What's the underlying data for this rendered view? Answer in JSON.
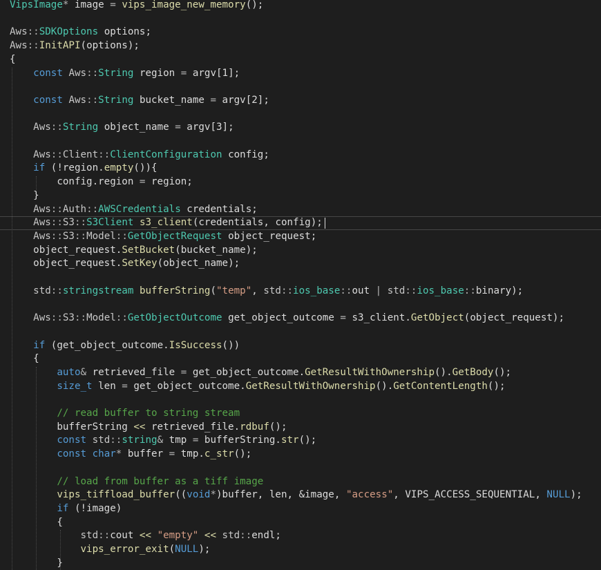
{
  "theme": {
    "background": "#1e1e1e",
    "text": "#dcdcdc",
    "keyword": "#569cd6",
    "type": "#4ec9b0",
    "function": "#dcdcaa",
    "string": "#d69d85",
    "comment": "#57a64a",
    "macro": "#b8d7a3"
  },
  "editor": {
    "current_line": 16,
    "lines": [
      [
        {
          "c": "t",
          "x": "VipsImage"
        },
        {
          "c": "op",
          "x": "* "
        },
        {
          "c": "v",
          "x": "image"
        },
        {
          "c": "op",
          "x": " = "
        },
        {
          "c": "f",
          "x": "vips_image_new_memory"
        },
        {
          "c": "p",
          "x": "();"
        }
      ],
      [],
      [
        {
          "c": "ns",
          "x": "Aws"
        },
        {
          "c": "op",
          "x": "::"
        },
        {
          "c": "t",
          "x": "SDKOptions"
        },
        {
          "c": "p",
          "x": " "
        },
        {
          "c": "v",
          "x": "options"
        },
        {
          "c": "p",
          "x": ";"
        }
      ],
      [
        {
          "c": "ns",
          "x": "Aws"
        },
        {
          "c": "op",
          "x": "::"
        },
        {
          "c": "f",
          "x": "InitAPI"
        },
        {
          "c": "p",
          "x": "("
        },
        {
          "c": "v",
          "x": "options"
        },
        {
          "c": "p",
          "x": ");"
        }
      ],
      [
        {
          "c": "p",
          "x": "{"
        }
      ],
      [
        {
          "c": "p",
          "x": "    "
        },
        {
          "c": "k",
          "x": "const"
        },
        {
          "c": "p",
          "x": " "
        },
        {
          "c": "ns",
          "x": "Aws"
        },
        {
          "c": "op",
          "x": "::"
        },
        {
          "c": "t",
          "x": "String"
        },
        {
          "c": "p",
          "x": " "
        },
        {
          "c": "v",
          "x": "region"
        },
        {
          "c": "op",
          "x": " = "
        },
        {
          "c": "v",
          "x": "argv"
        },
        {
          "c": "p",
          "x": "[1];"
        }
      ],
      [],
      [
        {
          "c": "p",
          "x": "    "
        },
        {
          "c": "k",
          "x": "const"
        },
        {
          "c": "p",
          "x": " "
        },
        {
          "c": "ns",
          "x": "Aws"
        },
        {
          "c": "op",
          "x": "::"
        },
        {
          "c": "t",
          "x": "String"
        },
        {
          "c": "p",
          "x": " "
        },
        {
          "c": "v",
          "x": "bucket_name"
        },
        {
          "c": "op",
          "x": " = "
        },
        {
          "c": "v",
          "x": "argv"
        },
        {
          "c": "p",
          "x": "[2];"
        }
      ],
      [],
      [
        {
          "c": "p",
          "x": "    "
        },
        {
          "c": "ns",
          "x": "Aws"
        },
        {
          "c": "op",
          "x": "::"
        },
        {
          "c": "t",
          "x": "String"
        },
        {
          "c": "p",
          "x": " "
        },
        {
          "c": "v",
          "x": "object_name"
        },
        {
          "c": "op",
          "x": " = "
        },
        {
          "c": "v",
          "x": "argv"
        },
        {
          "c": "p",
          "x": "[3];"
        }
      ],
      [],
      [
        {
          "c": "p",
          "x": "    "
        },
        {
          "c": "ns",
          "x": "Aws"
        },
        {
          "c": "op",
          "x": "::"
        },
        {
          "c": "ns",
          "x": "Client"
        },
        {
          "c": "op",
          "x": "::"
        },
        {
          "c": "t",
          "x": "ClientConfiguration"
        },
        {
          "c": "p",
          "x": " "
        },
        {
          "c": "v",
          "x": "config"
        },
        {
          "c": "p",
          "x": ";"
        }
      ],
      [
        {
          "c": "p",
          "x": "    "
        },
        {
          "c": "k",
          "x": "if"
        },
        {
          "c": "p",
          "x": " (!"
        },
        {
          "c": "v",
          "x": "region"
        },
        {
          "c": "p",
          "x": "."
        },
        {
          "c": "f",
          "x": "empty"
        },
        {
          "c": "p",
          "x": "()){"
        }
      ],
      [
        {
          "c": "p",
          "x": "        "
        },
        {
          "c": "v",
          "x": "config"
        },
        {
          "c": "p",
          "x": "."
        },
        {
          "c": "v",
          "x": "region"
        },
        {
          "c": "op",
          "x": " = "
        },
        {
          "c": "v",
          "x": "region"
        },
        {
          "c": "p",
          "x": ";"
        }
      ],
      [
        {
          "c": "p",
          "x": "    }"
        }
      ],
      [
        {
          "c": "p",
          "x": "    "
        },
        {
          "c": "ns",
          "x": "Aws"
        },
        {
          "c": "op",
          "x": "::"
        },
        {
          "c": "ns",
          "x": "Auth"
        },
        {
          "c": "op",
          "x": "::"
        },
        {
          "c": "t",
          "x": "AWSCredentials"
        },
        {
          "c": "p",
          "x": " "
        },
        {
          "c": "v",
          "x": "credentials"
        },
        {
          "c": "p",
          "x": ";"
        }
      ],
      [
        {
          "c": "p",
          "x": "    "
        },
        {
          "c": "ns",
          "x": "Aws"
        },
        {
          "c": "op",
          "x": "::"
        },
        {
          "c": "ns",
          "x": "S3"
        },
        {
          "c": "op",
          "x": "::"
        },
        {
          "c": "t",
          "x": "S3Client"
        },
        {
          "c": "p",
          "x": " "
        },
        {
          "c": "f",
          "x": "s3_client"
        },
        {
          "c": "p",
          "x": "("
        },
        {
          "c": "v",
          "x": "credentials"
        },
        {
          "c": "p",
          "x": ", "
        },
        {
          "c": "v",
          "x": "config"
        },
        {
          "c": "p",
          "x": ");"
        }
      ],
      [
        {
          "c": "p",
          "x": "    "
        },
        {
          "c": "ns",
          "x": "Aws"
        },
        {
          "c": "op",
          "x": "::"
        },
        {
          "c": "ns",
          "x": "S3"
        },
        {
          "c": "op",
          "x": "::"
        },
        {
          "c": "ns",
          "x": "Model"
        },
        {
          "c": "op",
          "x": "::"
        },
        {
          "c": "t",
          "x": "GetObjectRequest"
        },
        {
          "c": "p",
          "x": " "
        },
        {
          "c": "v",
          "x": "object_request"
        },
        {
          "c": "p",
          "x": ";"
        }
      ],
      [
        {
          "c": "p",
          "x": "    "
        },
        {
          "c": "v",
          "x": "object_request"
        },
        {
          "c": "p",
          "x": "."
        },
        {
          "c": "f",
          "x": "SetBucket"
        },
        {
          "c": "p",
          "x": "("
        },
        {
          "c": "v",
          "x": "bucket_name"
        },
        {
          "c": "p",
          "x": ");"
        }
      ],
      [
        {
          "c": "p",
          "x": "    "
        },
        {
          "c": "v",
          "x": "object_request"
        },
        {
          "c": "p",
          "x": "."
        },
        {
          "c": "f",
          "x": "SetKey"
        },
        {
          "c": "p",
          "x": "("
        },
        {
          "c": "v",
          "x": "object_name"
        },
        {
          "c": "p",
          "x": ");"
        }
      ],
      [],
      [
        {
          "c": "p",
          "x": "    "
        },
        {
          "c": "ns",
          "x": "std"
        },
        {
          "c": "op",
          "x": "::"
        },
        {
          "c": "t",
          "x": "stringstream"
        },
        {
          "c": "p",
          "x": " "
        },
        {
          "c": "f",
          "x": "bufferString"
        },
        {
          "c": "p",
          "x": "("
        },
        {
          "c": "s",
          "x": "\"temp\""
        },
        {
          "c": "p",
          "x": ", "
        },
        {
          "c": "ns",
          "x": "std"
        },
        {
          "c": "op",
          "x": "::"
        },
        {
          "c": "t",
          "x": "ios_base"
        },
        {
          "c": "op",
          "x": "::"
        },
        {
          "c": "v",
          "x": "out"
        },
        {
          "c": "op",
          "x": " | "
        },
        {
          "c": "ns",
          "x": "std"
        },
        {
          "c": "op",
          "x": "::"
        },
        {
          "c": "t",
          "x": "ios_base"
        },
        {
          "c": "op",
          "x": "::"
        },
        {
          "c": "v",
          "x": "binary"
        },
        {
          "c": "p",
          "x": ");"
        }
      ],
      [],
      [
        {
          "c": "p",
          "x": "    "
        },
        {
          "c": "ns",
          "x": "Aws"
        },
        {
          "c": "op",
          "x": "::"
        },
        {
          "c": "ns",
          "x": "S3"
        },
        {
          "c": "op",
          "x": "::"
        },
        {
          "c": "ns",
          "x": "Model"
        },
        {
          "c": "op",
          "x": "::"
        },
        {
          "c": "t",
          "x": "GetObjectOutcome"
        },
        {
          "c": "p",
          "x": " "
        },
        {
          "c": "v",
          "x": "get_object_outcome"
        },
        {
          "c": "op",
          "x": " = "
        },
        {
          "c": "v",
          "x": "s3_client"
        },
        {
          "c": "p",
          "x": "."
        },
        {
          "c": "f",
          "x": "GetObject"
        },
        {
          "c": "p",
          "x": "("
        },
        {
          "c": "v",
          "x": "object_request"
        },
        {
          "c": "p",
          "x": ");"
        }
      ],
      [],
      [
        {
          "c": "p",
          "x": "    "
        },
        {
          "c": "k",
          "x": "if"
        },
        {
          "c": "p",
          "x": " ("
        },
        {
          "c": "v",
          "x": "get_object_outcome"
        },
        {
          "c": "p",
          "x": "."
        },
        {
          "c": "f",
          "x": "IsSuccess"
        },
        {
          "c": "p",
          "x": "())"
        }
      ],
      [
        {
          "c": "p",
          "x": "    {"
        }
      ],
      [
        {
          "c": "p",
          "x": "        "
        },
        {
          "c": "k",
          "x": "auto"
        },
        {
          "c": "op",
          "x": "& "
        },
        {
          "c": "v",
          "x": "retrieved_file"
        },
        {
          "c": "op",
          "x": " = "
        },
        {
          "c": "v",
          "x": "get_object_outcome"
        },
        {
          "c": "p",
          "x": "."
        },
        {
          "c": "f",
          "x": "GetResultWithOwnership"
        },
        {
          "c": "p",
          "x": "()."
        },
        {
          "c": "f",
          "x": "GetBody"
        },
        {
          "c": "p",
          "x": "();"
        }
      ],
      [
        {
          "c": "p",
          "x": "        "
        },
        {
          "c": "k",
          "x": "size_t"
        },
        {
          "c": "p",
          "x": " "
        },
        {
          "c": "v",
          "x": "len"
        },
        {
          "c": "op",
          "x": " = "
        },
        {
          "c": "v",
          "x": "get_object_outcome"
        },
        {
          "c": "p",
          "x": "."
        },
        {
          "c": "f",
          "x": "GetResultWithOwnership"
        },
        {
          "c": "p",
          "x": "()."
        },
        {
          "c": "f",
          "x": "GetContentLength"
        },
        {
          "c": "p",
          "x": "();"
        }
      ],
      [],
      [
        {
          "c": "p",
          "x": "        "
        },
        {
          "c": "c",
          "x": "// read buffer to string stream"
        }
      ],
      [
        {
          "c": "p",
          "x": "        "
        },
        {
          "c": "v",
          "x": "bufferString"
        },
        {
          "c": "f",
          "x": " << "
        },
        {
          "c": "v",
          "x": "retrieved_file"
        },
        {
          "c": "p",
          "x": "."
        },
        {
          "c": "f",
          "x": "rdbuf"
        },
        {
          "c": "p",
          "x": "();"
        }
      ],
      [
        {
          "c": "p",
          "x": "        "
        },
        {
          "c": "k",
          "x": "const"
        },
        {
          "c": "p",
          "x": " "
        },
        {
          "c": "ns",
          "x": "std"
        },
        {
          "c": "op",
          "x": "::"
        },
        {
          "c": "t",
          "x": "string"
        },
        {
          "c": "op",
          "x": "& "
        },
        {
          "c": "v",
          "x": "tmp"
        },
        {
          "c": "op",
          "x": " = "
        },
        {
          "c": "v",
          "x": "bufferString"
        },
        {
          "c": "p",
          "x": "."
        },
        {
          "c": "f",
          "x": "str"
        },
        {
          "c": "p",
          "x": "();"
        }
      ],
      [
        {
          "c": "p",
          "x": "        "
        },
        {
          "c": "k",
          "x": "const"
        },
        {
          "c": "p",
          "x": " "
        },
        {
          "c": "k",
          "x": "char"
        },
        {
          "c": "op",
          "x": "* "
        },
        {
          "c": "v",
          "x": "buffer"
        },
        {
          "c": "op",
          "x": " = "
        },
        {
          "c": "v",
          "x": "tmp"
        },
        {
          "c": "p",
          "x": "."
        },
        {
          "c": "f",
          "x": "c_str"
        },
        {
          "c": "p",
          "x": "();"
        }
      ],
      [],
      [
        {
          "c": "p",
          "x": "        "
        },
        {
          "c": "c",
          "x": "// load from buffer as a tiff image"
        }
      ],
      [
        {
          "c": "p",
          "x": "        "
        },
        {
          "c": "f",
          "x": "vips_tiffload_buffer"
        },
        {
          "c": "p",
          "x": "(("
        },
        {
          "c": "k",
          "x": "void"
        },
        {
          "c": "op",
          "x": "*"
        },
        {
          "c": "p",
          "x": ")"
        },
        {
          "c": "v",
          "x": "buffer"
        },
        {
          "c": "p",
          "x": ", "
        },
        {
          "c": "v",
          "x": "len"
        },
        {
          "c": "p",
          "x": ", &"
        },
        {
          "c": "v",
          "x": "image"
        },
        {
          "c": "p",
          "x": ", "
        },
        {
          "c": "s",
          "x": "\"access\""
        },
        {
          "c": "p",
          "x": ", "
        },
        {
          "c": "v",
          "x": "VIPS_ACCESS_SEQUENTIAL"
        },
        {
          "c": "p",
          "x": ", "
        },
        {
          "c": "k",
          "x": "NULL"
        },
        {
          "c": "p",
          "x": ");"
        }
      ],
      [
        {
          "c": "p",
          "x": "        "
        },
        {
          "c": "k",
          "x": "if"
        },
        {
          "c": "p",
          "x": " (!"
        },
        {
          "c": "v",
          "x": "image"
        },
        {
          "c": "p",
          "x": ")"
        }
      ],
      [
        {
          "c": "p",
          "x": "        {"
        }
      ],
      [
        {
          "c": "p",
          "x": "            "
        },
        {
          "c": "ns",
          "x": "std"
        },
        {
          "c": "op",
          "x": "::"
        },
        {
          "c": "v",
          "x": "cout"
        },
        {
          "c": "f",
          "x": " << "
        },
        {
          "c": "s",
          "x": "\"empty\""
        },
        {
          "c": "f",
          "x": " << "
        },
        {
          "c": "ns",
          "x": "std"
        },
        {
          "c": "op",
          "x": "::"
        },
        {
          "c": "v",
          "x": "endl"
        },
        {
          "c": "p",
          "x": ";"
        }
      ],
      [
        {
          "c": "p",
          "x": "            "
        },
        {
          "c": "f",
          "x": "vips_error_exit"
        },
        {
          "c": "p",
          "x": "("
        },
        {
          "c": "k",
          "x": "NULL"
        },
        {
          "c": "p",
          "x": ");"
        }
      ],
      [
        {
          "c": "p",
          "x": "        }"
        }
      ]
    ]
  }
}
